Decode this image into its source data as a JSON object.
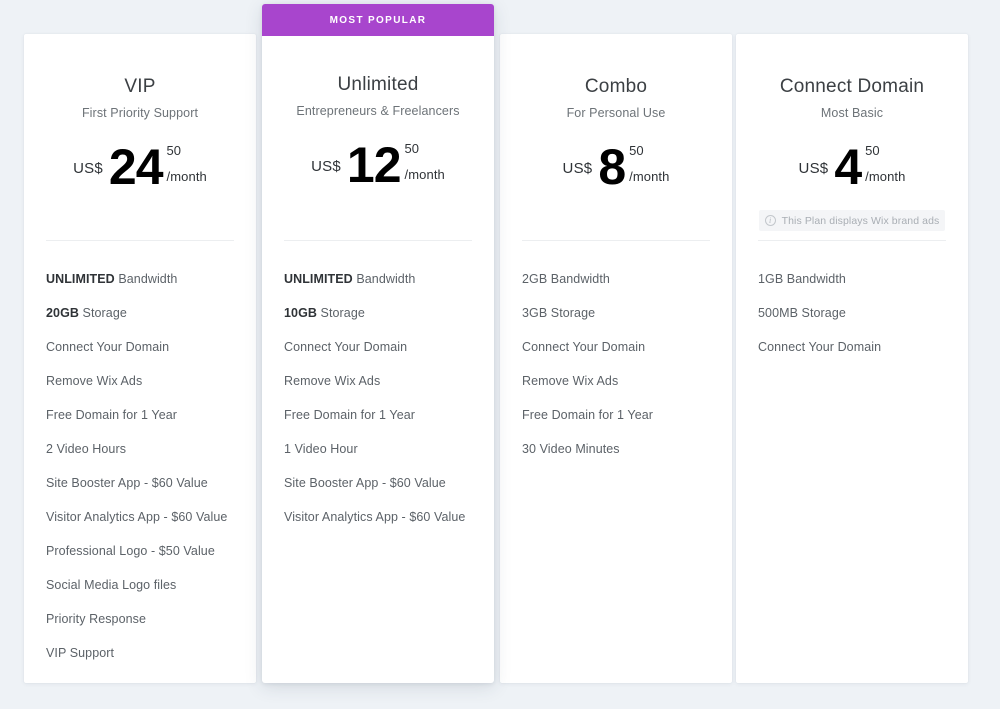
{
  "page": {
    "background_color": "#eef2f6",
    "accent_color": "#a845cd"
  },
  "ribbon": {
    "label": "MOST POPULAR"
  },
  "currency_label": "US$",
  "period_label": "/month",
  "ads_notice": {
    "icon": "info-icon",
    "text": "This Plan displays Wix brand ads"
  },
  "plans": [
    {
      "name": "VIP",
      "tagline": "First Priority Support",
      "currency": "US$",
      "price_int": "24",
      "price_cents": "50",
      "period": "/month",
      "highlighted": false,
      "has_ads_notice": false,
      "features": [
        {
          "bold": "UNLIMITED",
          "rest": " Bandwidth"
        },
        {
          "bold": "20GB",
          "rest": " Storage"
        },
        {
          "bold": "",
          "rest": "Connect Your Domain"
        },
        {
          "bold": "",
          "rest": "Remove Wix Ads"
        },
        {
          "bold": "",
          "rest": "Free Domain for 1 Year"
        },
        {
          "bold": "",
          "rest": "2 Video Hours"
        },
        {
          "bold": "",
          "rest": "Site Booster App - $60 Value"
        },
        {
          "bold": "",
          "rest": "Visitor Analytics App - $60 Value"
        },
        {
          "bold": "",
          "rest": "Professional Logo - $50 Value"
        },
        {
          "bold": "",
          "rest": "Social Media Logo files"
        },
        {
          "bold": "",
          "rest": "Priority Response"
        },
        {
          "bold": "",
          "rest": "VIP Support"
        }
      ]
    },
    {
      "name": "Unlimited",
      "tagline": "Entrepreneurs & Freelancers",
      "currency": "US$",
      "price_int": "12",
      "price_cents": "50",
      "period": "/month",
      "highlighted": true,
      "has_ads_notice": false,
      "features": [
        {
          "bold": "UNLIMITED",
          "rest": " Bandwidth"
        },
        {
          "bold": "10GB",
          "rest": " Storage"
        },
        {
          "bold": "",
          "rest": "Connect Your Domain"
        },
        {
          "bold": "",
          "rest": "Remove Wix Ads"
        },
        {
          "bold": "",
          "rest": "Free Domain for 1 Year"
        },
        {
          "bold": "",
          "rest": "1 Video Hour"
        },
        {
          "bold": "",
          "rest": "Site Booster App - $60 Value"
        },
        {
          "bold": "",
          "rest": "Visitor Analytics App - $60 Value"
        }
      ]
    },
    {
      "name": "Combo",
      "tagline": "For Personal Use",
      "currency": "US$",
      "price_int": "8",
      "price_cents": "50",
      "period": "/month",
      "highlighted": false,
      "has_ads_notice": false,
      "features": [
        {
          "bold": "",
          "rest": "2GB Bandwidth"
        },
        {
          "bold": "",
          "rest": "3GB Storage"
        },
        {
          "bold": "",
          "rest": "Connect Your Domain"
        },
        {
          "bold": "",
          "rest": "Remove Wix Ads"
        },
        {
          "bold": "",
          "rest": "Free Domain for 1 Year"
        },
        {
          "bold": "",
          "rest": "30 Video Minutes"
        }
      ]
    },
    {
      "name": "Connect Domain",
      "tagline": "Most Basic",
      "currency": "US$",
      "price_int": "4",
      "price_cents": "50",
      "period": "/month",
      "highlighted": false,
      "has_ads_notice": true,
      "features": [
        {
          "bold": "",
          "rest": "1GB Bandwidth"
        },
        {
          "bold": "",
          "rest": "500MB Storage"
        },
        {
          "bold": "",
          "rest": "Connect Your Domain"
        }
      ]
    }
  ]
}
